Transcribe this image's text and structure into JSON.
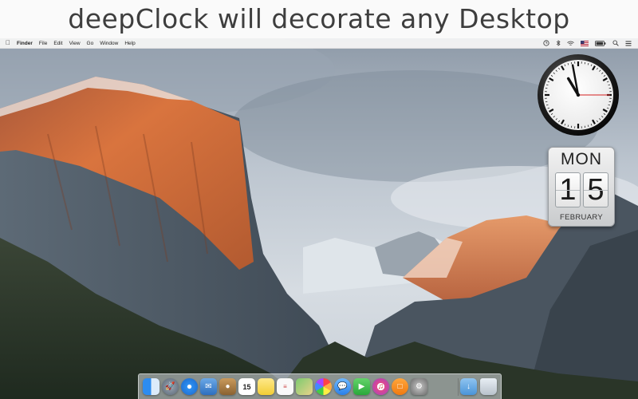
{
  "headline": "deepClock will decorate any Desktop",
  "menubar": {
    "apple_icon": "apple-icon",
    "items": [
      "Finder",
      "File",
      "Edit",
      "View",
      "Go",
      "Window",
      "Help"
    ],
    "status_icons": [
      "clock-status-icon",
      "bluetooth-icon",
      "wifi-icon",
      "flag-icon",
      "battery-icon",
      "spotlight-icon",
      "menu-list-icon"
    ]
  },
  "clock": {
    "hours": 10,
    "minutes": 58,
    "seconds": 15
  },
  "calendar": {
    "day": "MON",
    "digit1": "1",
    "digit2": "5",
    "month": "FEBRUARY"
  },
  "dock": {
    "icons": [
      "finder-icon",
      "launchpad-icon",
      "safari-icon",
      "mail-icon",
      "contacts-icon",
      "calendar-icon",
      "notes-icon",
      "reminders-icon",
      "maps-icon",
      "photos-icon",
      "messages-icon",
      "facetime-icon",
      "itunes-icon",
      "ibooks-icon",
      "system-preferences-icon",
      "downloads-folder-icon",
      "trash-icon"
    ],
    "calendar_date": "15"
  }
}
